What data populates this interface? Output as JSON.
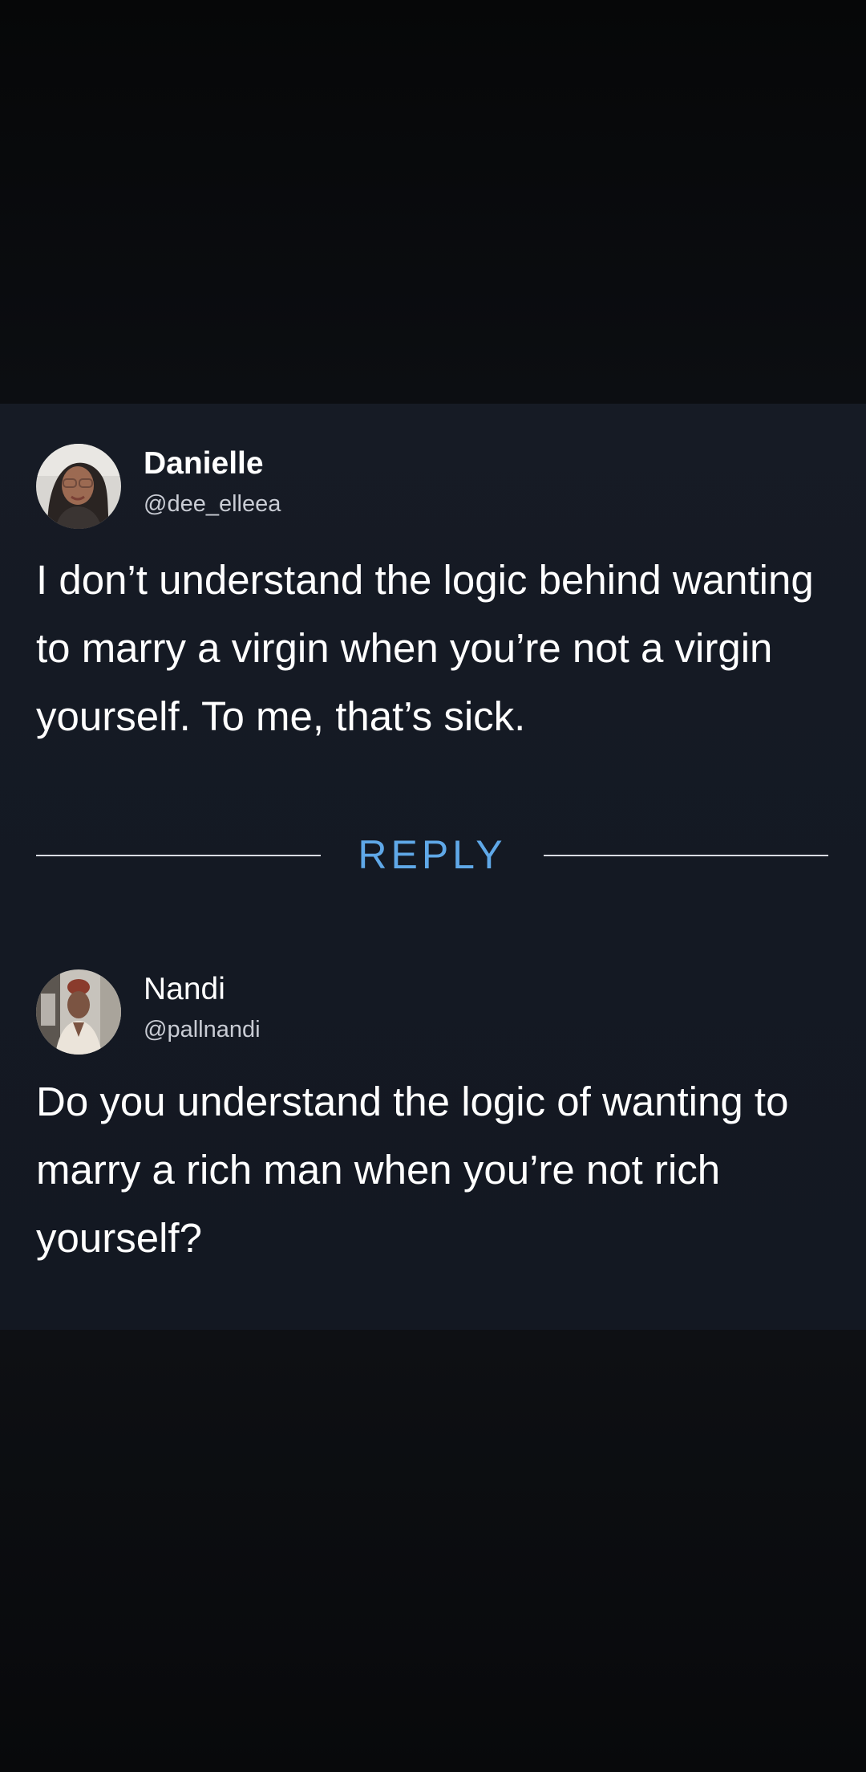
{
  "posts": [
    {
      "author": "Danielle",
      "handle": "@dee_elleea",
      "text": "I don’t understand the logic behind wanting to marry a virgin when you’re not a virgin yourself. To me, that’s sick."
    },
    {
      "author": "Nandi",
      "handle": "@pallnandi",
      "text": "Do you understand the logic of wanting to marry a rich man when you’re not rich yourself?"
    }
  ],
  "divider": {
    "label": "REPLY"
  },
  "colors": {
    "card_background": "#151a24",
    "page_background": "#0a0b0e",
    "text_primary": "#ffffff",
    "text_secondary": "#c9ccd4",
    "accent": "#5fa8e8"
  }
}
